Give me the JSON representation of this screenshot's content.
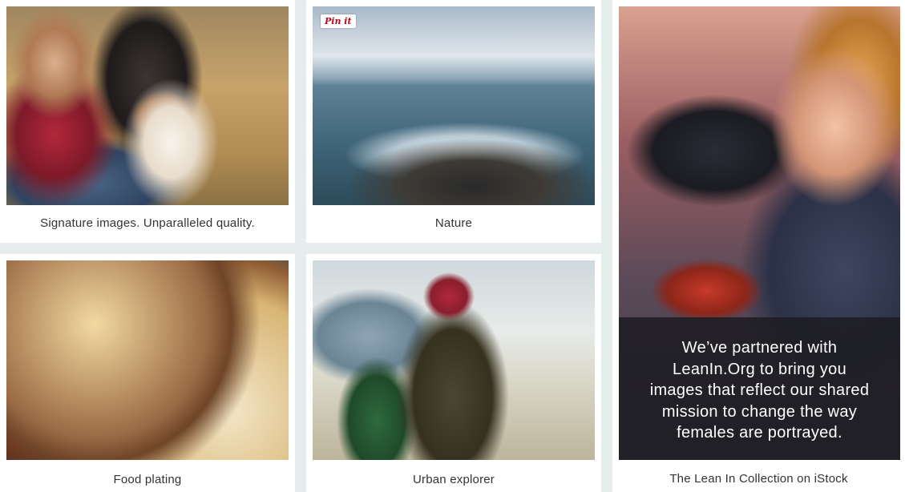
{
  "tiles": [
    {
      "id": "dog",
      "caption": "Signature images. Unparalleled quality."
    },
    {
      "id": "nature",
      "caption": "Nature",
      "pin_label": "Pin it"
    },
    {
      "id": "food",
      "caption": "Food plating"
    },
    {
      "id": "urban",
      "caption": "Urban explorer"
    },
    {
      "id": "leanin",
      "caption": "The Lean In Collection on iStock",
      "overlay_lines": [
        "We’ve partnered with",
        "LeanIn.Org to bring you",
        "images that reflect our shared",
        "mission to change the way",
        "females are portrayed."
      ]
    }
  ]
}
